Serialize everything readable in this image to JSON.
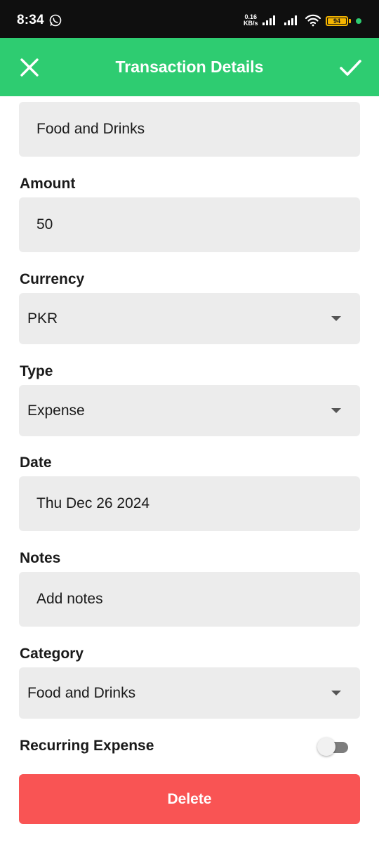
{
  "status_bar": {
    "time": "8:34",
    "speed_value": "0.16",
    "speed_unit": "KB/s",
    "battery": "94"
  },
  "app_bar": {
    "title": "Transaction Details",
    "close_icon": "close-icon",
    "confirm_icon": "check-icon"
  },
  "form": {
    "name": {
      "value": "Food and Drinks"
    },
    "amount": {
      "label": "Amount",
      "value": "50"
    },
    "currency": {
      "label": "Currency",
      "value": "PKR"
    },
    "type": {
      "label": "Type",
      "value": "Expense"
    },
    "date": {
      "label": "Date",
      "value": "Thu Dec 26 2024"
    },
    "notes": {
      "label": "Notes",
      "placeholder": "Add notes"
    },
    "category": {
      "label": "Category",
      "value": "Food and Drinks"
    },
    "recurring": {
      "label": "Recurring Expense",
      "enabled": false
    }
  },
  "delete_label": "Delete",
  "colors": {
    "primary": "#2ecc71",
    "danger": "#f95454",
    "field_bg": "#ececec"
  }
}
